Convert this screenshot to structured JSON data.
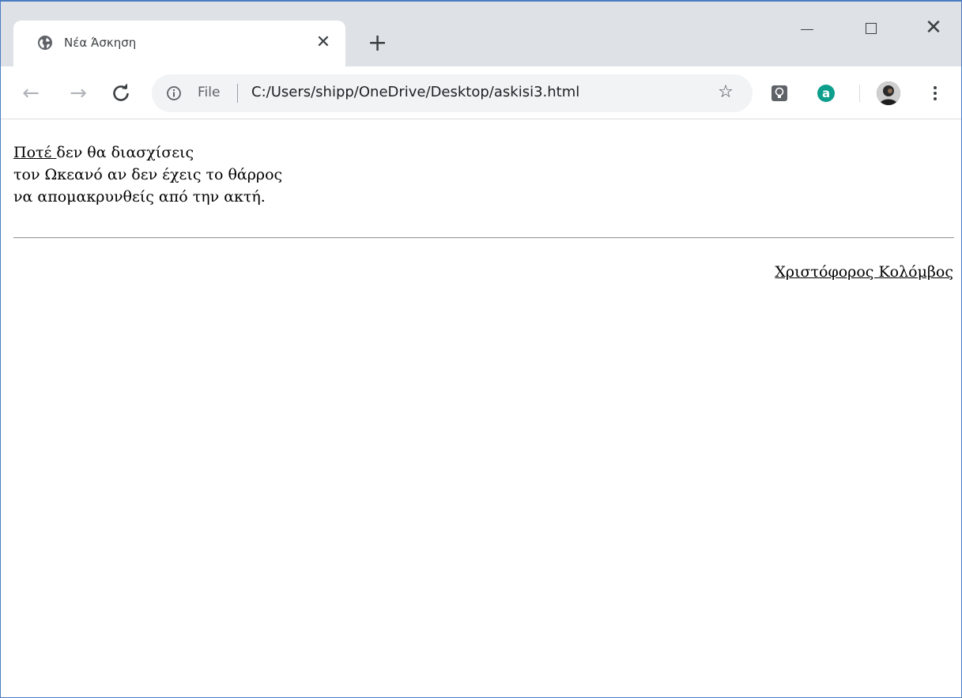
{
  "window": {
    "controls": {
      "minimize_icon": "minimize-icon",
      "maximize_icon": "maximize-icon",
      "close_glyph": "✕"
    }
  },
  "tab": {
    "title": "Νέα Άσκηση",
    "favicon": "globe-icon",
    "close_glyph": "✕"
  },
  "new_tab_glyph": "+",
  "toolbar": {
    "back_glyph": "←",
    "forward_glyph": "→",
    "reload_glyph": "C",
    "scheme_label": "File",
    "url": "C:/Users/shipp/OneDrive/Desktop/askisi3.html",
    "star_glyph": "☆",
    "extensions": [
      "lightbulb-extension-icon",
      "a-extension-icon"
    ],
    "accent_colors": {
      "extension_a": "#0d9e8c",
      "extension_bulb": "#5f6368"
    }
  },
  "page": {
    "poem_lines": {
      "first_link": "Ποτέ ",
      "first_rest": "δεν θα διασχίσεις",
      "second": "τον Ωκεανό αν δεν έχεις το θάρρος",
      "third": "να απομακρυνθείς από την ακτή."
    },
    "author": "Χριστόφορος Κολόμβος"
  }
}
